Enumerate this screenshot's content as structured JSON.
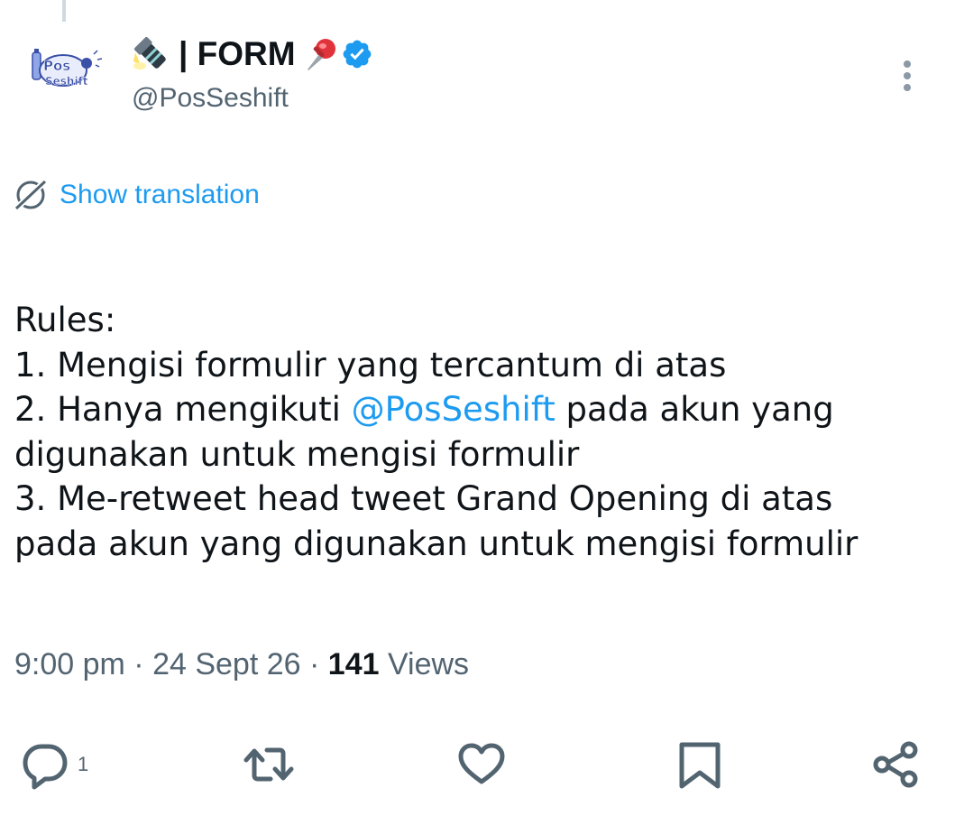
{
  "tweet": {
    "author": {
      "display_name": "| FORM",
      "handle": "@PosSeshift",
      "verified": true,
      "avatar_logo_text": "Pos Seshift"
    },
    "translate_label": "Show translation",
    "body": {
      "line1": "Rules:",
      "line2": "1. Mengisi formulir yang tercantum di atas",
      "line3_prefix": "2. Hanya mengikuti ",
      "line3_mention": "@PosSeshift",
      "line3_suffix": " pada akun yang",
      "line4": "digunakan untuk mengisi formulir",
      "line5": "3. Me-retweet head tweet Grand Opening di atas",
      "line6": "pada akun yang digunakan untuk mengisi formulir"
    },
    "meta": {
      "time": "9:00 pm",
      "separator": " · ",
      "date": "24 Sept 26",
      "views_count": "141",
      "views_label": " Views"
    },
    "actions": {
      "reply_count": "1"
    }
  },
  "colors": {
    "text": "#0f1419",
    "secondary": "#536471",
    "link": "#1d9bf0",
    "verified": "#1d9bf0",
    "icon": "#536471"
  },
  "icons": [
    "flashlight-emoji",
    "pushpin-emoji",
    "verified-badge-icon",
    "more-icon",
    "translate-icon",
    "reply-icon",
    "retweet-icon",
    "like-icon",
    "bookmark-icon",
    "share-icon"
  ]
}
